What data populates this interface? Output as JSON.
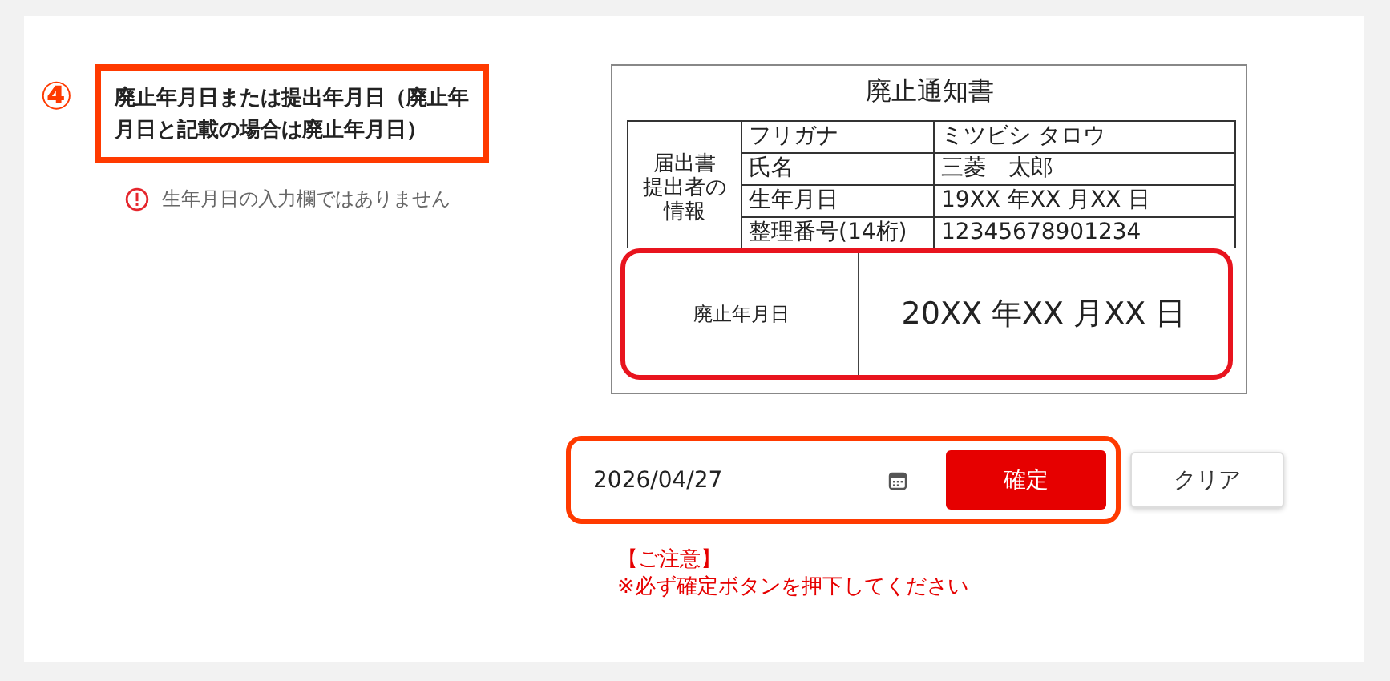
{
  "step": {
    "number": "④",
    "title": "廃止年月日または提出年月日（廃止年月日と記載の場合は廃止年月日）",
    "warning": "生年月日の入力欄ではありません"
  },
  "document": {
    "title": "廃止通知書",
    "group_label_lines": [
      "届出書",
      "提出者の",
      "情報"
    ],
    "rows": [
      {
        "label": "フリガナ",
        "value": "ミツビシ タロウ"
      },
      {
        "label": "氏名",
        "value": "三菱　太郎"
      },
      {
        "label": "生年月日",
        "value": "19XX 年XX 月XX 日"
      },
      {
        "label": "整理番号(14桁)",
        "value": "12345678901234"
      }
    ],
    "highlight": {
      "label": "廃止年月日",
      "value": "20XX 年XX 月XX 日"
    }
  },
  "date_field": {
    "value": "2026/04/27"
  },
  "buttons": {
    "confirm": "確定",
    "clear": "クリア"
  },
  "notice": [
    "【ご注意】",
    "※必ず確定ボタンを押下してください"
  ]
}
